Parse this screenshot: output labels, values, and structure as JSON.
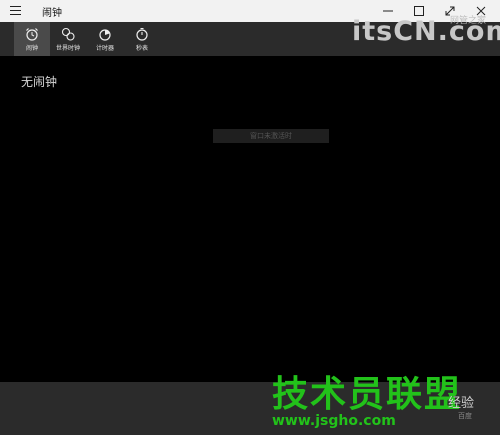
{
  "window": {
    "title": "闹钟"
  },
  "tabs": [
    {
      "label": "闹钟",
      "icon": "alarm-clock-icon",
      "active": true
    },
    {
      "label": "世界时钟",
      "icon": "globe-icon",
      "active": false
    },
    {
      "label": "计时器",
      "icon": "timer-icon",
      "active": false
    },
    {
      "label": "秒表",
      "icon": "stopwatch-icon",
      "active": false
    }
  ],
  "main": {
    "empty_text": "无闹钟",
    "notice_text": "窗口未激活时"
  },
  "watermarks": {
    "site_logo": "itsCN.com",
    "site_sub": "网管之家",
    "overlay_title": "技术员联盟",
    "overlay_url": "www.jsgho.com",
    "corner_text": "经验",
    "corner_small": "百度"
  },
  "colors": {
    "titlebar_bg": "#f2f2f2",
    "toolbar_bg": "#2b2b2b",
    "active_tab_bg": "#4a4a4a",
    "content_bg": "#000000",
    "watermark_green": "#22c21a"
  }
}
